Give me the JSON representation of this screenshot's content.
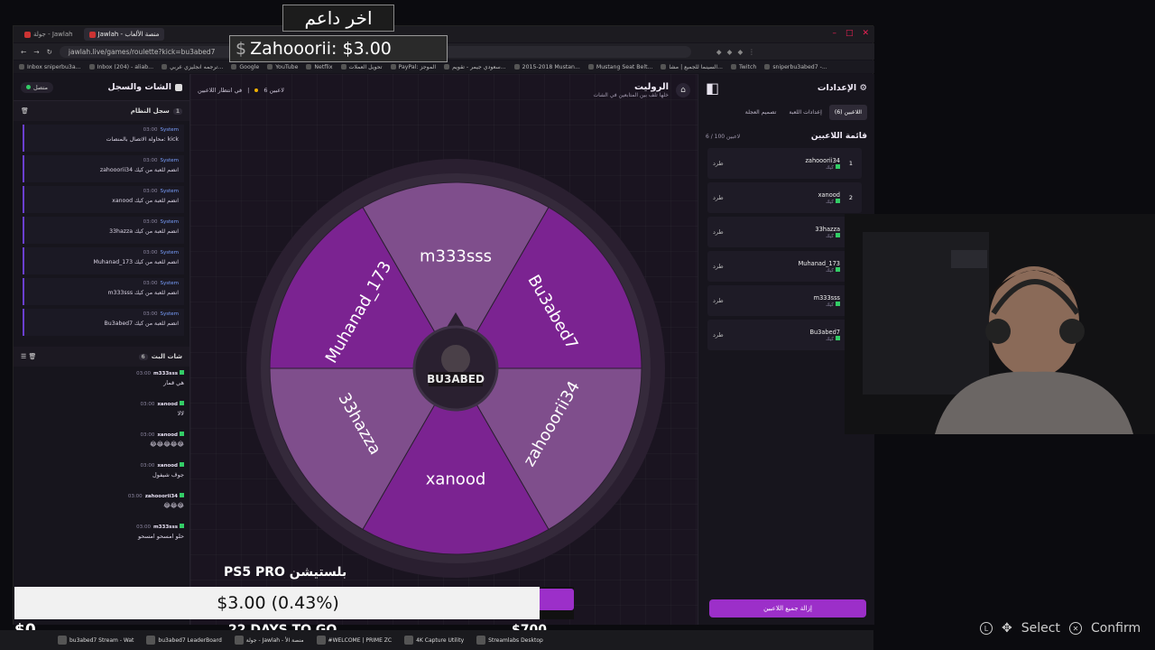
{
  "browser": {
    "tabs": [
      "جولة - Jawlah",
      "Jawlah - منصة الألعاب"
    ],
    "active_tab": "جولة - Jawlah - منصة الألعاب",
    "url": "jawlah.live/games/roulette?kick=bu3abed7",
    "bookmarks": [
      "Inbox sniperbu3a...",
      "Inbox (204) - aliab...",
      "ترجمه انجليزي عربي...",
      "Google",
      "YouTube",
      "Netflix",
      "تحويل العملات",
      "PayPal: الموجز",
      "سعودي جيمر - تقويم...",
      "2015-2018 Mustan...",
      "Mustang Seat Belt...",
      "السينما للجميع | مشا...",
      "Twitch",
      "sniperbu3abed7 -..."
    ]
  },
  "chat_panel": {
    "title": "الشات والسجل",
    "status": "متصل",
    "system_log_title": "سجل النظام",
    "system_log_count": "1",
    "system_items": [
      {
        "user": "System",
        "time": "03:00",
        "text": "محاولة الاتصال بالمنصات: kick"
      },
      {
        "user": "System",
        "time": "03:00",
        "text": "zahooorii34 انضم للعبة من كيك"
      },
      {
        "user": "System",
        "time": "03:00",
        "text": "xanood انضم للعبة من كيك"
      },
      {
        "user": "System",
        "time": "03:00",
        "text": "33hazza انضم للعبة من كيك"
      },
      {
        "user": "System",
        "time": "03:00",
        "text": "Muhanad_173 انضم للعبة من كيك"
      },
      {
        "user": "System",
        "time": "03:00",
        "text": "m333sss انضم للعبة من كيك"
      },
      {
        "user": "System",
        "time": "03:00",
        "text": "Bu3abed7 انضم للعبة من كيك"
      }
    ],
    "live_chat_title": "شات البث",
    "live_chat_count": "6",
    "messages": [
      {
        "user": "m333sss",
        "time": "03:00",
        "text": "هي قمار"
      },
      {
        "user": "xanood",
        "time": "03:00",
        "text": "لالا"
      },
      {
        "user": "xanood",
        "time": "03:00",
        "text": "😂😂😂😂😂"
      },
      {
        "user": "xanood",
        "time": "03:00",
        "text": "جوف شيفول"
      },
      {
        "user": "zahooorii34",
        "time": "03:00",
        "text": "😂😂😂"
      },
      {
        "user": "m333sss",
        "time": "03:00",
        "text": "حلو امسحو امسحو"
      }
    ]
  },
  "game": {
    "title": "الروليت",
    "subtitle": "خلها تلف بين المتابعين في الشات",
    "status_waiting": "في انتظار اللاعبين",
    "players_count": "6 لاعبين",
    "logo_text": "BU3ABED",
    "segments": [
      "m333sss",
      "Bu3abed7",
      "zahooorii34",
      "xanood",
      "33hazza",
      "Muhanad_173"
    ]
  },
  "settings_panel": {
    "title": "الإعدادات",
    "tabs": [
      "اللاعبين (6)",
      "إعدادات اللعبة",
      "تصميم العجلة"
    ],
    "list_title": "قائمة اللاعبين",
    "list_count": "6 / 100 لاعبين",
    "kick_label": "طرد",
    "platform_label": "كيك",
    "players": [
      {
        "rank": "1",
        "name": "zahooorii34"
      },
      {
        "rank": "2",
        "name": "xanood"
      },
      {
        "rank": "",
        "name": "33hazza"
      },
      {
        "rank": "",
        "name": "Muhanad_173"
      },
      {
        "rank": "",
        "name": "m333sss"
      },
      {
        "rank": "",
        "name": "Bu3abed7"
      }
    ],
    "remove_all": "إزالة جميع اللاعبين"
  },
  "overlay": {
    "last_donor_label": "اخر داعم",
    "last_donor": "Zahooorii: $3.00",
    "goal_title": "PS5 PRO بلستيشن",
    "goal_progress_text": "$3.00 (0.43%)",
    "goal_fraction": 0.0043,
    "goal_start": "$0",
    "goal_target": "$700",
    "goal_days": "22 DAYS TO GO",
    "select_hint": "Select",
    "confirm_hint": "Confirm"
  },
  "taskbar": [
    "bu3abed7 Stream - Wat",
    "bu3abed7 LeaderBoard",
    "جولة - Jawlah - منصة الأ",
    "#WELCOME | PRIME ZC",
    "4K Capture Utility",
    "Streamlabs Desktop"
  ],
  "colors": {
    "accent": "#9c2fc9",
    "segment_dark": "#7b2391",
    "segment_light": "#7f4e8c"
  }
}
